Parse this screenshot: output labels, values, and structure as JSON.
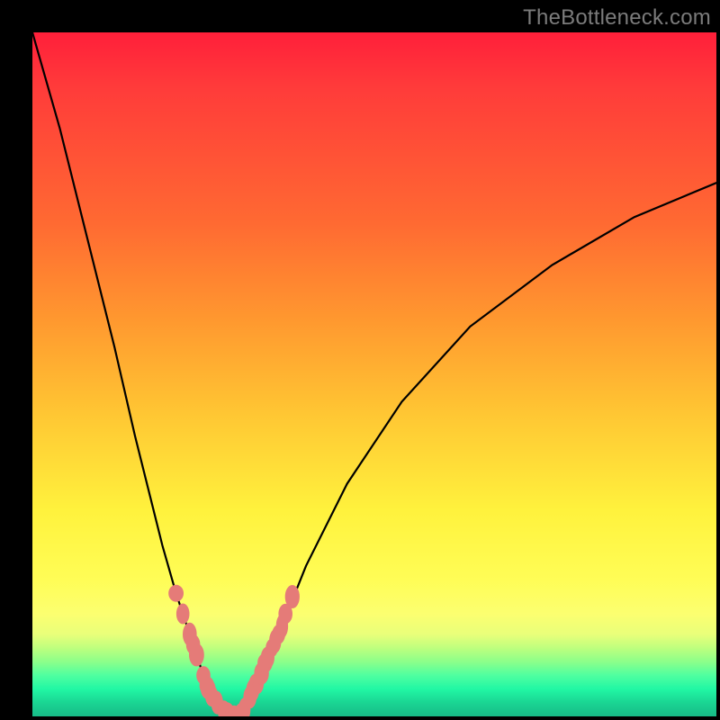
{
  "watermark": "TheBottleneck.com",
  "chart_data": {
    "type": "line",
    "title": "",
    "xlabel": "",
    "ylabel": "",
    "xlim": [
      0,
      100
    ],
    "ylim": [
      0,
      100
    ],
    "series": [
      {
        "name": "bottleneck-curve",
        "x": [
          0,
          4,
          8,
          12,
          15,
          17,
          19,
          21,
          23,
          25,
          27,
          29,
          30,
          31,
          33,
          36,
          40,
          46,
          54,
          64,
          76,
          88,
          100
        ],
        "values": [
          100,
          86,
          70,
          54,
          41,
          33,
          25,
          18,
          12,
          6,
          2,
          0,
          0,
          1,
          5,
          12,
          22,
          34,
          46,
          57,
          66,
          73,
          78
        ]
      }
    ],
    "markers": {
      "name": "highlight-points",
      "x": [
        21,
        22,
        23,
        23.5,
        24,
        25,
        25.5,
        25.7,
        26.2,
        27,
        28,
        28.5,
        29,
        29.5,
        30,
        30.5,
        31,
        31.8,
        32.2,
        32.5,
        33,
        33.5,
        34,
        34.4,
        35,
        35.5,
        36,
        36.5,
        37,
        38
      ],
      "values": [
        18,
        15,
        12,
        10.5,
        9,
        6,
        4.5,
        4,
        3,
        2,
        0.8,
        0.4,
        0,
        0,
        0,
        0.2,
        1,
        2.8,
        3.8,
        4.5,
        5,
        6.3,
        7.8,
        8.6,
        10,
        11,
        12,
        13.2,
        15,
        17.5
      ],
      "color": "#e57b78"
    },
    "notes": "The plot shows a V-shaped curve over a red-to-green vertical gradient background. The x-axis and y-axis have no visible tick labels; values are estimated on a 0–100 normalized scale. Minimum of the curve is near x≈29–30, y≈0. Salmon-colored marker points are clustered along both arms of the V near the bottom."
  }
}
